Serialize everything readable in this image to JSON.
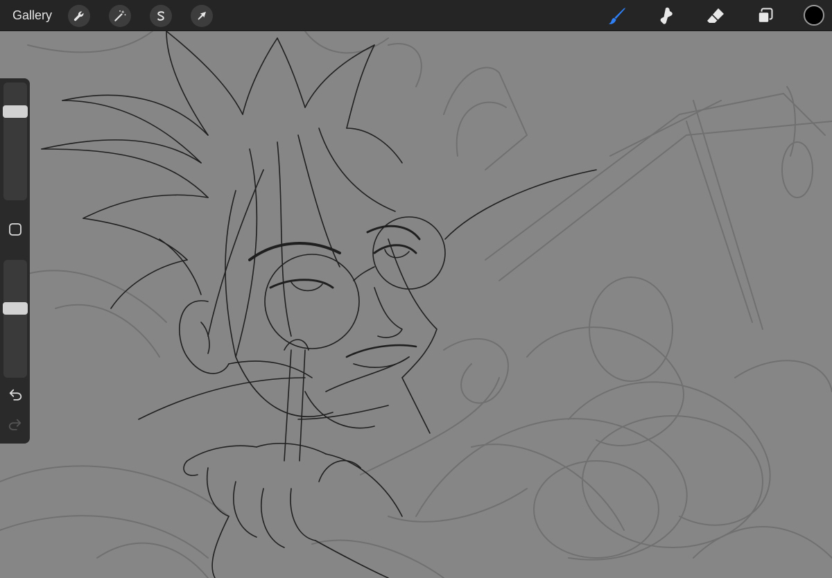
{
  "app": {
    "gallery_label": "Gallery"
  },
  "toolbar": {
    "left_tools": [
      "wrench-icon",
      "magic-wand-icon",
      "selection-s-icon",
      "arrow-move-icon"
    ],
    "right_tools": [
      "brush-icon",
      "smudge-icon",
      "eraser-icon",
      "layers-icon"
    ],
    "active_tool": "brush",
    "active_color": "#000000",
    "accent_color": "#2f7ff5"
  },
  "sidebar": {
    "brush_size_level": 0.78,
    "opacity_level": 0.6,
    "modify_button": "square-icon",
    "undo_icon": "undo-icon",
    "redo_icon": "redo-icon"
  }
}
